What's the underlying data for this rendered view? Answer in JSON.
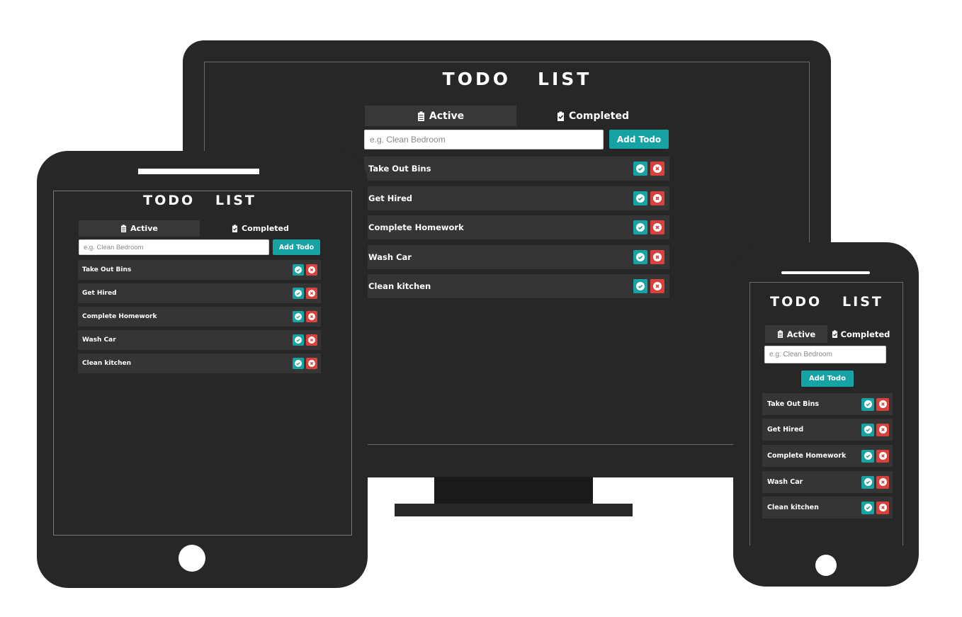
{
  "app": {
    "title": "TODO   LIST",
    "tabs": {
      "active": "Active",
      "completed": "Completed"
    },
    "input": {
      "placeholder": "e.g. Clean Bedroom",
      "value": ""
    },
    "add_button": "Add Todo",
    "todos": [
      {
        "text": "Take Out Bins"
      },
      {
        "text": "Get Hired"
      },
      {
        "text": "Complete Homework"
      },
      {
        "text": "Wash Car"
      },
      {
        "text": "Clean kitchen"
      }
    ]
  },
  "colors": {
    "device": "#272727",
    "item_bg": "#353535",
    "accent": "#17a2a3",
    "danger": "#d9413d",
    "text": "#ffffff"
  },
  "icons": {
    "tab_active": "clipboard-icon",
    "tab_completed": "clipboard-check-icon",
    "complete": "check-circle-icon",
    "delete": "times-circle-icon"
  }
}
